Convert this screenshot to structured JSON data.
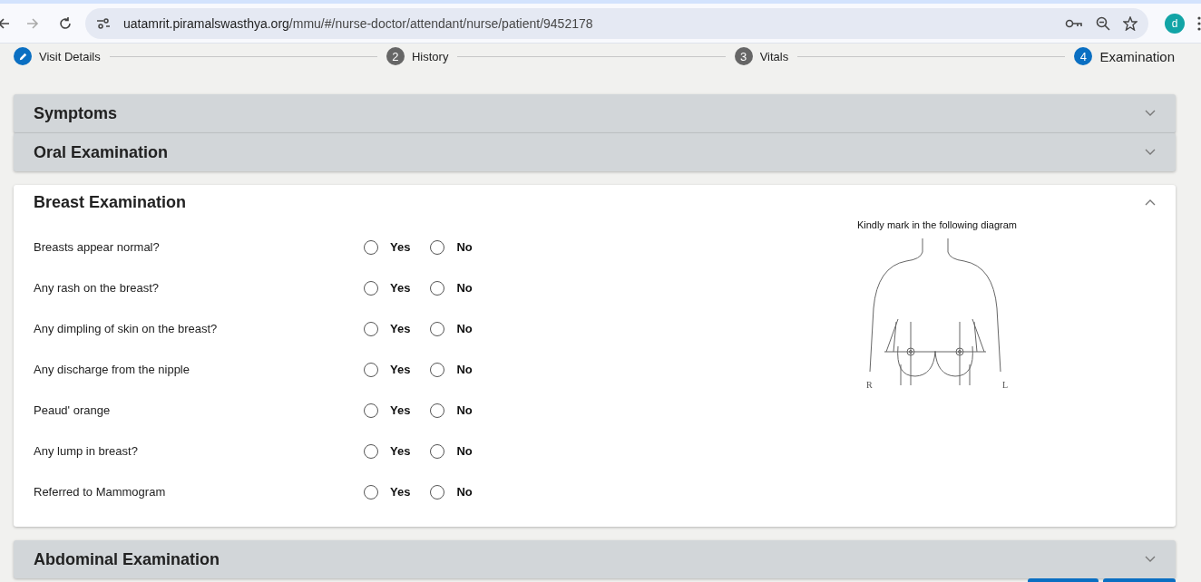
{
  "browser": {
    "url_host": "uatamrit.piramalswasthya.org",
    "url_path": "/mmu/#/nurse-doctor/attendant/nurse/patient/9452178",
    "profile": "d"
  },
  "stepper": [
    {
      "kind": "edit",
      "label": "Visit Details",
      "selected": false
    },
    {
      "kind": "number",
      "number": "2",
      "label": "History",
      "selected": false
    },
    {
      "kind": "number",
      "number": "3",
      "label": "Vitals",
      "selected": false
    },
    {
      "kind": "number",
      "number": "4",
      "label": "Examination",
      "selected": true
    }
  ],
  "panels": [
    {
      "title": "Symptoms",
      "expanded": false
    },
    {
      "title": "Oral Examination",
      "expanded": false
    },
    {
      "title": "Breast Examination",
      "expanded": true,
      "questions": [
        {
          "label": "Breasts appear normal?",
          "options": [
            {
              "label": "Yes",
              "selected": false
            },
            {
              "label": "No",
              "selected": false
            }
          ]
        },
        {
          "label": "Any rash on the breast?",
          "options": [
            {
              "label": "Yes",
              "selected": false
            },
            {
              "label": "No",
              "selected": false
            }
          ]
        },
        {
          "label": "Any dimpling of skin on the breast?",
          "options": [
            {
              "label": "Yes",
              "selected": false
            },
            {
              "label": "No",
              "selected": false
            }
          ]
        },
        {
          "label": "Any discharge from the nipple",
          "options": [
            {
              "label": "Yes",
              "selected": false
            },
            {
              "label": "No",
              "selected": false
            }
          ]
        },
        {
          "label": "Peaud' orange",
          "options": [
            {
              "label": "Yes",
              "selected": false
            },
            {
              "label": "No",
              "selected": false
            }
          ]
        },
        {
          "label": "Any lump in breast?",
          "options": [
            {
              "label": "Yes",
              "selected": false
            },
            {
              "label": "No",
              "selected": false
            }
          ]
        },
        {
          "label": "Referred to Mammogram",
          "options": [
            {
              "label": "Yes",
              "selected": false
            },
            {
              "label": "No",
              "selected": false
            }
          ]
        }
      ],
      "diagram": {
        "caption": "Kindly mark in the following diagram",
        "right_label": "R",
        "left_label": "L"
      }
    },
    {
      "title": "Abdominal Examination",
      "expanded": false
    }
  ],
  "footer_buttons": [
    {
      "kind": "primary"
    },
    {
      "kind": "primary"
    }
  ]
}
